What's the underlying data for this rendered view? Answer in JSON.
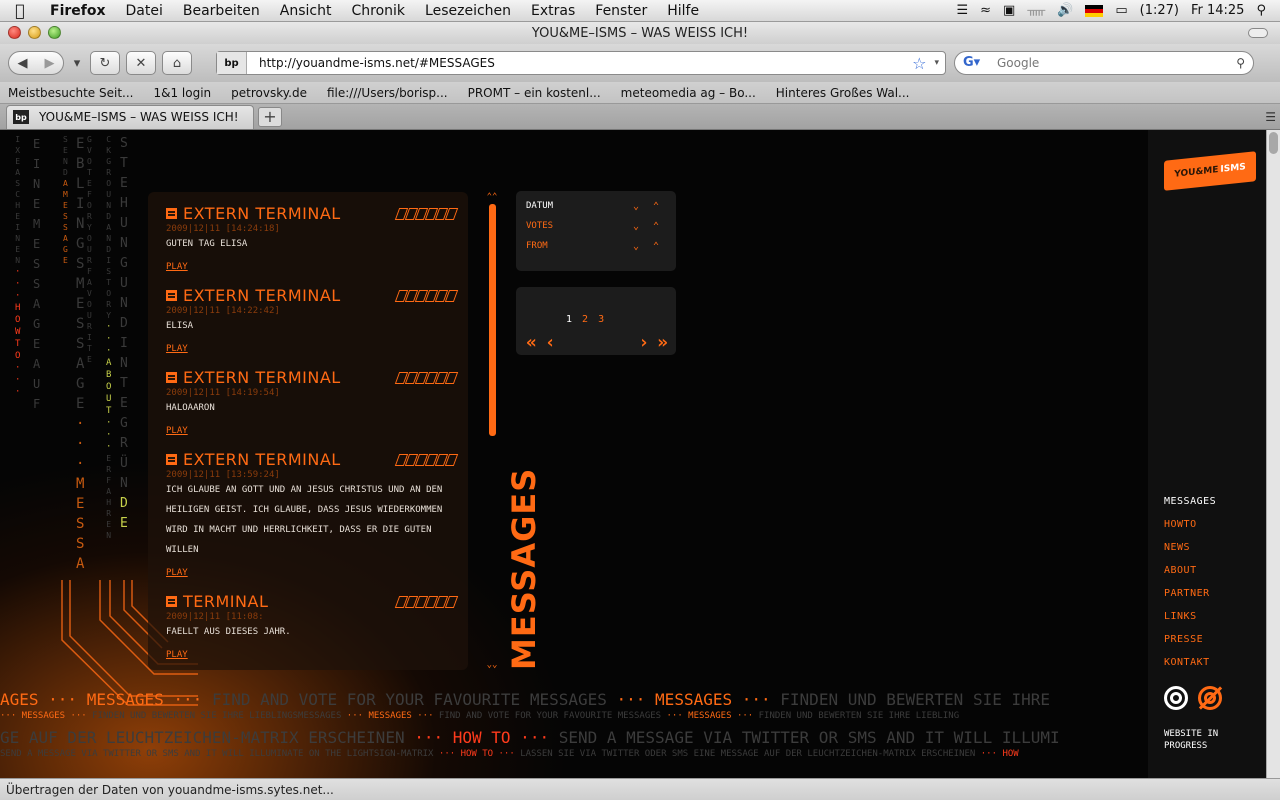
{
  "menubar": {
    "app": "Firefox",
    "items": [
      "Datei",
      "Bearbeiten",
      "Ansicht",
      "Chronik",
      "Lesezeichen",
      "Extras",
      "Fenster",
      "Hilfe"
    ],
    "battery": "(1:27)",
    "clock": "Fr 14:25"
  },
  "window": {
    "title": "YOU&ME–ISMS – WAS WEISS ICH!"
  },
  "navbar": {
    "site_badge": "bp",
    "url": "http://youandme-isms.net/#MESSAGES",
    "search_placeholder": "Google"
  },
  "bookmarks": [
    "Meistbesuchte Seit...",
    "1&1 login",
    "petrovsky.de",
    "file:///Users/borisp...",
    "PROMT – ein kostenl...",
    "meteomedia ag – Bo...",
    "Hinteres Großes Wal..."
  ],
  "tabs": [
    {
      "label": "YOU&ME–ISMS – WAS WEISS ICH!"
    }
  ],
  "status": "Übertragen der Daten von youandme-isms.sytes.net...",
  "columns": {
    "c1": [
      "I",
      "X",
      "E",
      "A",
      "S",
      "C",
      "H",
      "E",
      "I",
      "N",
      "E",
      "N",
      "·",
      "·",
      "·",
      "H",
      "O",
      "W",
      "T",
      "O",
      "·",
      "·",
      "·"
    ],
    "c2": [
      "E",
      "I",
      "N",
      "E",
      "M",
      "E",
      "S",
      "S",
      "A",
      "G",
      "E",
      "A",
      "U",
      "F"
    ],
    "c3": [
      "S",
      "E",
      "N",
      "D",
      "A",
      "M",
      "E",
      "S",
      "S",
      "A",
      "G",
      "E"
    ],
    "c4": [
      "G",
      "V",
      "O",
      "T",
      "E",
      "F",
      "O",
      "R",
      "Y",
      "O",
      "U",
      "R",
      "F",
      "A",
      "V",
      "O",
      "U",
      "R",
      "I",
      "T",
      "E"
    ],
    "c5": [
      "E",
      "B",
      "L",
      "I",
      "N",
      "G",
      "S",
      "M",
      "E",
      "S",
      "S",
      "A",
      "G",
      "E",
      "·",
      "·",
      "·",
      "M",
      "E",
      "S",
      "S",
      "A"
    ],
    "c6": [
      "C",
      "K",
      "G",
      "R",
      "O",
      "U",
      "N",
      "D",
      "A",
      "N",
      "D",
      "I",
      "S",
      "T",
      "O",
      "R",
      "Y",
      "·",
      "·",
      "·",
      "A",
      "B",
      "O",
      "U",
      "T",
      "·",
      "·",
      "·",
      "E",
      "R",
      "F",
      "A",
      "H",
      "R",
      "E",
      "N"
    ],
    "c7": [
      "S",
      "T",
      "E",
      "H",
      "U",
      "N",
      "G",
      "U",
      "N",
      "D",
      "I",
      "N",
      "T",
      "E",
      "G",
      "R",
      "Ü",
      "N",
      "D",
      "E"
    ]
  },
  "messages": [
    {
      "title": "EXTERN TERMINAL",
      "date": "2009|12|11 [14:24:18]",
      "text": "GUTEN TAG ELISA",
      "play": "PLAY"
    },
    {
      "title": "EXTERN TERMINAL",
      "date": "2009|12|11 [14:22:42]",
      "text": "ELISA",
      "play": "PLAY"
    },
    {
      "title": "EXTERN TERMINAL",
      "date": "2009|12|11 [14:19:54]",
      "text": "HALOAARON",
      "play": "PLAY"
    },
    {
      "title": "EXTERN TERMINAL",
      "date": "2009|12|11 [13:59:24]",
      "text": "ICH GLAUBE AN GOTT UND AN JESUS CHRISTUS UND AN DEN HEILIGEN GEIST. ICH GLAUBE, DASS JESUS WIEDERKOMMEN WIRD IN MACHT UND HERRLICHKEIT, DASS ER DIE GUTEN WILLEN",
      "play": "PLAY"
    },
    {
      "title": "TERMINAL",
      "date": "2009|12|11 [11:08:",
      "text": "FAELLT AUS DIESES JAHR.",
      "play": "PLAY"
    }
  ],
  "sort": {
    "rows": [
      {
        "label": "DATUM",
        "color": "#ffffff"
      },
      {
        "label": "VOTES",
        "color": "#ff6a14"
      },
      {
        "label": "FROM",
        "color": "#ff6a14"
      }
    ]
  },
  "pager": {
    "pages": [
      "1",
      "2",
      "3"
    ],
    "current": "1"
  },
  "section_title": "MESSAGES",
  "sidebar": {
    "logo_a": "YOU&ME",
    "logo_b": "ISMS",
    "nav": [
      "MESSAGES",
      "HOWTO",
      "NEWS",
      "ABOUT",
      "PARTNER",
      "LINKS",
      "PRESSE",
      "KONTAKT"
    ],
    "active": "MESSAGES",
    "wip": "WEBSITE IN PROGRESS"
  },
  "tickers": {
    "t1": [
      {
        "text": "AGES ··· ",
        "c": "o"
      },
      {
        "text": "MESSAGES",
        "c": "o"
      },
      {
        "text": " ··· ",
        "c": "o"
      },
      {
        "text": "FIND AND VOTE FOR YOUR FAVOURITE MESSAGES  ",
        "c": "d"
      },
      {
        "text": "··· MESSAGES ··· ",
        "c": "o"
      },
      {
        "text": "FINDEN UND BEWERTEN SIE IHRE",
        "c": "d"
      }
    ],
    "t2": [
      {
        "text": "      ··· MESSAGES ··· ",
        "c": "o"
      },
      {
        "text": "FINDEN UND BEWERTEN SIE IHRE LIEBLINGSMESSAGES ",
        "c": "d"
      },
      {
        "text": "··· MESSAGES ··· ",
        "c": "o"
      },
      {
        "text": "FIND AND VOTE FOR YOUR FAVOURITE MESSAGES ",
        "c": "d"
      },
      {
        "text": "··· MESSAGES ··· ",
        "c": "o"
      },
      {
        "text": "FINDEN UND BEWERTEN SIE IHRE LIEBLING",
        "c": "d"
      }
    ],
    "t3": [
      {
        "text": "GE AUF DER LEUCHTZEICHEN-MATRIX ERSCHEINEN ",
        "c": "d"
      },
      {
        "text": "··· HOW TO ··· ",
        "c": "r"
      },
      {
        "text": "SEND A MESSAGE VIA TWITTER OR SMS AND IT WILL ILLUMI",
        "c": "d"
      }
    ],
    "t4": [
      {
        "text": "        SEND A MESSAGE VIA TWITTER OR SMS AND IT WILL ILLUMINATE ON THE LIGHTSIGN-MATRIX ",
        "c": "d"
      },
      {
        "text": "··· HOW TO ··· ",
        "c": "r"
      },
      {
        "text": "LASSEN SIE VIA TWITTER ODER SMS EINE MESSAGE AUF DER LEUCHTZEICHEN-MATRIX ERSCHEINEN ",
        "c": "d"
      },
      {
        "text": "··· HOW",
        "c": "r"
      }
    ]
  }
}
